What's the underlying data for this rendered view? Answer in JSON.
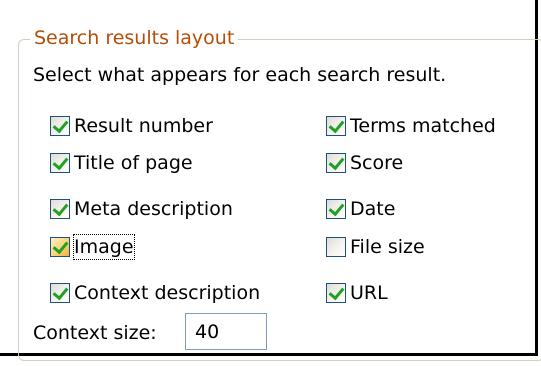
{
  "group": {
    "title": "Search results layout",
    "intro": "Select what appears for each search result."
  },
  "options": {
    "result_number": {
      "label": "Result number",
      "checked": true
    },
    "terms_matched": {
      "label": "Terms matched",
      "checked": true
    },
    "title_of_page": {
      "label": "Title of page",
      "checked": true
    },
    "score": {
      "label": "Score",
      "checked": true
    },
    "meta_description": {
      "label": "Meta description",
      "checked": true
    },
    "date": {
      "label": "Date",
      "checked": true
    },
    "image": {
      "label": "Image",
      "checked": true,
      "hovered": true,
      "focused": true
    },
    "file_size": {
      "label": "File size",
      "checked": false
    },
    "context_description": {
      "label": "Context description",
      "checked": true
    },
    "url": {
      "label": "URL",
      "checked": true
    }
  },
  "context_size": {
    "label": "Context size:",
    "value": "40"
  },
  "colors": {
    "legend_text": "#b44e08",
    "group_border": "#d0d0bf",
    "checkbox_border": "#1c5180",
    "check_mark": "#21a121",
    "hover_fill": "#f9d06e",
    "input_border": "#7f9db9"
  }
}
